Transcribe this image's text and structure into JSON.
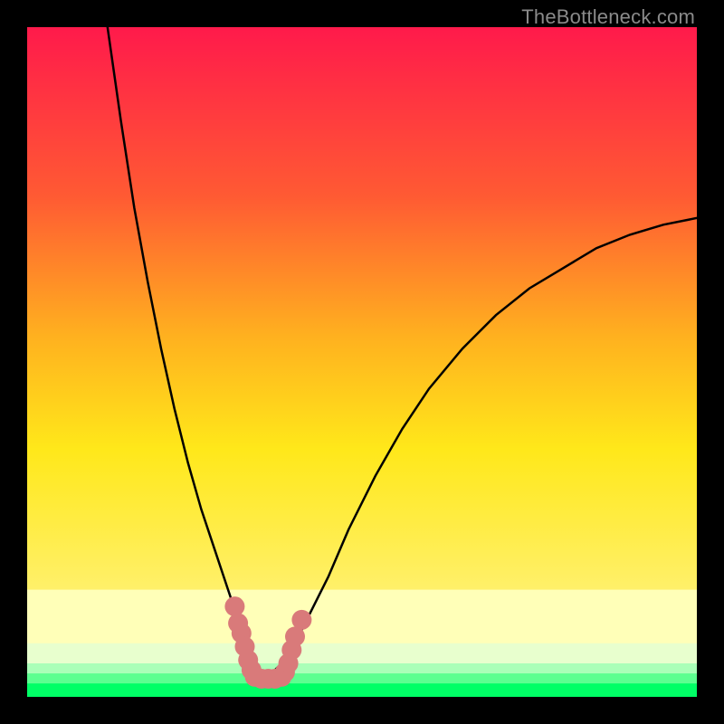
{
  "watermark": "TheBottleneck.com",
  "colors": {
    "frame": "#000000",
    "top": "#ff1a4b",
    "mid_upper": "#ff7a2e",
    "mid": "#ffd21a",
    "mid_lower": "#fff06a",
    "band_pale": "#ffffb8",
    "band_green1": "#8fffa8",
    "band_green2": "#00ff66",
    "curve": "#000000",
    "marker": "#d97a7a"
  },
  "chart_data": {
    "type": "line",
    "title": "",
    "xlabel": "",
    "ylabel": "",
    "xlim": [
      0,
      100
    ],
    "ylim": [
      0,
      100
    ],
    "series": [
      {
        "name": "bottleneck-curve-left",
        "x": [
          12,
          14,
          16,
          18,
          20,
          22,
          24,
          26,
          28,
          30,
          32,
          33,
          34,
          35
        ],
        "y": [
          100,
          86,
          73,
          62,
          52,
          43,
          35,
          28,
          22,
          16,
          10,
          7,
          5,
          3
        ]
      },
      {
        "name": "bottleneck-curve-right",
        "x": [
          35,
          36,
          38,
          40,
          42,
          45,
          48,
          52,
          56,
          60,
          65,
          70,
          75,
          80,
          85,
          90,
          95,
          100
        ],
        "y": [
          3,
          3,
          5,
          8,
          12,
          18,
          25,
          33,
          40,
          46,
          52,
          57,
          61,
          64,
          67,
          69,
          70.5,
          71.5
        ]
      }
    ],
    "markers": [
      {
        "x": 31.0,
        "y": 13.5
      },
      {
        "x": 31.5,
        "y": 11.0
      },
      {
        "x": 32.0,
        "y": 9.5
      },
      {
        "x": 32.5,
        "y": 7.5
      },
      {
        "x": 33.0,
        "y": 5.5
      },
      {
        "x": 33.5,
        "y": 4.0
      },
      {
        "x": 34.0,
        "y": 3.0
      },
      {
        "x": 35.0,
        "y": 2.7
      },
      {
        "x": 36.0,
        "y": 2.7
      },
      {
        "x": 37.0,
        "y": 2.7
      },
      {
        "x": 38.0,
        "y": 3.0
      },
      {
        "x": 38.5,
        "y": 3.7
      },
      {
        "x": 39.0,
        "y": 5.0
      },
      {
        "x": 39.5,
        "y": 7.0
      },
      {
        "x": 40.0,
        "y": 9.0
      },
      {
        "x": 41.0,
        "y": 11.5
      }
    ],
    "gradient_bands": [
      {
        "from_y": 100,
        "to_y": 16,
        "type": "smooth",
        "stops": [
          "#ff1a4b",
          "#ff7a2e",
          "#ffd21a",
          "#fff06a"
        ]
      },
      {
        "from_y": 16,
        "to_y": 8,
        "type": "solid",
        "color": "#ffffb8"
      },
      {
        "from_y": 8,
        "to_y": 5,
        "type": "solid",
        "color": "#e8ffce"
      },
      {
        "from_y": 5,
        "to_y": 3.5,
        "type": "solid",
        "color": "#aaffb8"
      },
      {
        "from_y": 3.5,
        "to_y": 2,
        "type": "solid",
        "color": "#5cff90"
      },
      {
        "from_y": 2,
        "to_y": 0,
        "type": "solid",
        "color": "#00ff66"
      }
    ]
  }
}
